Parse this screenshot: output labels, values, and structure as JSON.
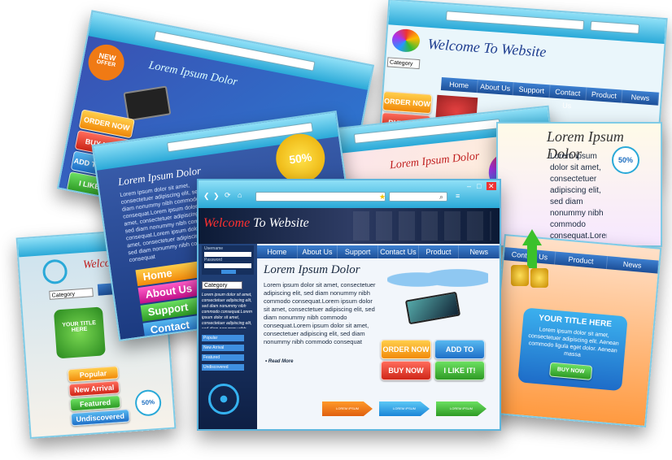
{
  "common": {
    "lorem_heading": "Lorem Ipsum Dolor",
    "lorem_paragraph": "Lorem ipsum dolor sit amet, consectetuer adipiscing elit, sed diam nonummy nibh commodo consequat.Lorem ipsum dolor sit amet, consectetuer adipiscing elit, sed diam nonummy nibh commodo consequat.Lorem ipsum dolor sit amet, consectetuer adipiscing elit, sed diam nonummy nibh commodo consequat",
    "read_more": "• Read More",
    "welcome_prefix": "Welcome",
    "welcome_suffix": "To Website",
    "welcome_full": "Welcome To Website"
  },
  "nav": [
    "Home",
    "About Us",
    "Support",
    "Contact Us",
    "Product",
    "News"
  ],
  "buttons": {
    "order_now": "ORDER NOW",
    "add_to_cart": "ADD TO CART",
    "buy_now": "BUY NOW",
    "i_like_it": "I LIKE IT!"
  },
  "category": "Category",
  "sidebar_links": [
    "Popular",
    "New Arrival",
    "Featured",
    "Undiscovered"
  ],
  "side_nav": [
    "Home",
    "About Us",
    "Support",
    "Contact"
  ],
  "badges": {
    "percent": "50%",
    "new_line1": "NEW",
    "new_line2": "OFFER"
  },
  "login": {
    "username": "Username",
    "password": "Password"
  },
  "promo": {
    "title": "YOUR TITLE HERE",
    "text": "Lorem ipsum dolor sit amet, consectetuer adipiscing elit. Aenean commodo ligula eget dolor. Aenean massa",
    "button": "BUY NOW"
  },
  "arrow_labels": [
    "LOREM IPSUM",
    "LOREM IPSUM",
    "LOREM IPSUM"
  ],
  "colors": {
    "chrome": "#2aa9d8",
    "nav": "#1d4f98",
    "orange": "#f28a0a",
    "blue": "#1f6fc8",
    "red": "#cf2618",
    "green": "#2e9a25"
  }
}
